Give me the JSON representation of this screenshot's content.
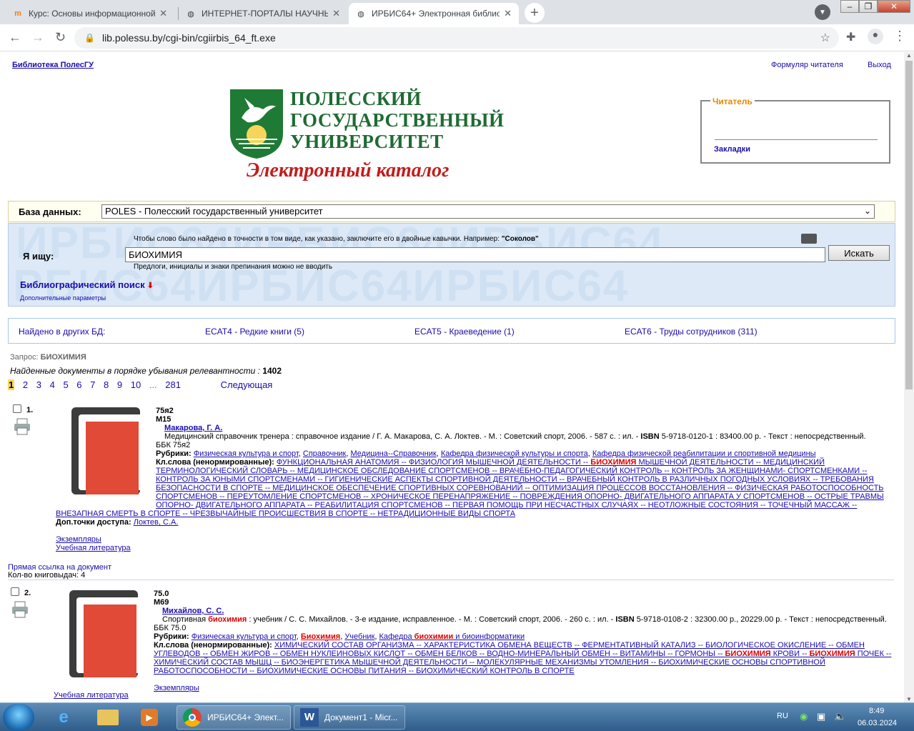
{
  "browser": {
    "tabs": [
      {
        "title": "Курс: Основы информационной ...",
        "favicon": "moodle-icon"
      },
      {
        "title": "ИНТЕРНЕТ-ПОРТАЛЫ НАУЧНЫХ ...",
        "favicon": "globe-icon"
      },
      {
        "title": "ИРБИС64+ Электронная библиотека",
        "favicon": "globe-icon"
      }
    ],
    "url": "lib.polessu.by/cgi-bin/cgiirbis_64_ft.exe"
  },
  "header": {
    "library_link": "Библиотека ПолесГУ",
    "reader_form_link": "Формуляр читателя",
    "logout_link": "Выход"
  },
  "logo": {
    "line1": "ПОЛЕССКИЙ",
    "line2": "ГОСУДАРСТВЕННЫЙ",
    "line3": "УНИВЕРСИТЕТ",
    "catalog": "Электронный каталог"
  },
  "reader_box": {
    "legend": "Читатель",
    "bookmarks": "Закладки"
  },
  "database": {
    "label": "База данных:",
    "selected": "POLES - Полесский государственный университет"
  },
  "search": {
    "hint_top_prefix": "Чтобы слово было найдено в точности в том виде, как указано, заключите его в двойные кавычки. Например:",
    "hint_top_example": "\"Соколов\"",
    "label": "Я ищу:",
    "query": "БИОХИМИЯ",
    "button": "Искать",
    "hint_bottom": "Предлоги, инициалы и знаки препинания можно не вводить",
    "biblio_link": "Библиографический поиск",
    "extra_link": "Дополнительные параметры"
  },
  "other_dbs": {
    "label": "Найдено в других БД:",
    "items": [
      "ECAT4 - Редкие книги (5)",
      "ECAT5 - Краеведение (1)",
      "ECAT6 - Труды сотрудников (311)"
    ]
  },
  "results": {
    "query_label": "Запрос:",
    "query_value": "БИОХИМИЯ",
    "found_label": "Найденные документы в порядке убывания релевантности :",
    "found_count": "1402",
    "pages": [
      "1",
      "2",
      "3",
      "4",
      "5",
      "6",
      "7",
      "8",
      "9",
      "10",
      "...",
      "281"
    ],
    "next": "Следующая"
  },
  "record1": {
    "num": "1.",
    "code1": "75я2",
    "code2": "М15",
    "author": "Макарова, Г. А.",
    "desc": "Медицинский справочник тренера : справочное издание / Г. А. Макарова, С. А. Локтев. - М. : Советский спорт, 2006. - 587 с. : ил. - ",
    "isbn_label": "ISBN",
    "isbn_rest": " 5-9718-0120-1 : 83400.00 р. - Текст : непосредственный.",
    "bbk": "ББК 75я2",
    "rubrics_label": "Рубрики:",
    "rubrics": [
      "Физическая культура и спорт",
      "Справочник",
      "Медицина--Справочник",
      "Кафедра физической культуры и спорта",
      "Кафедра физической реабилитации и спортивной медицины"
    ],
    "kw_label": "Кл.слова (ненормированные):",
    "kw_line1_a": "ФУНКЦИОНАЛЬНАЯ АНАТОМИЯ -- ФИЗИОЛОГИЯ МЫШЕЧНОЙ ДЕЯТЕЛЬНОСТИ -- ",
    "kw_line1_hl": "БИОХИМИЯ",
    "kw_line1_b": " МЫШЕЧНОЙ ДЕЯТЕЛЬНОСТИ -- МЕДИЦИНСКИЙ",
    "kw_lines": [
      "ТЕРМИНОЛОГИЧЕСКИЙ СЛОВАРЬ -- МЕДИЦИНСКОЕ ОБСЛЕДОВАНИЕ СПОРТСМЕНОВ -- ВРАЧЕБНО-ПЕДАГОГИЧЕСКИЙ КОНТРОЛЬ -- КОНТРОЛЬ ЗА ЖЕНЩИНАМИ- СПОРТСМЕНКАМИ --",
      "КОНТРОЛЬ ЗА ЮНЫМИ СПОРТСМЕНАМИ -- ГИГИЕНИЧЕСКИЕ АСПЕКТЫ СПОРТИВНОЙ ДЕЯТЕЛЬНОСТИ -- ВРАЧЕБНЫЙ КОНТРОЛЬ В РАЗЛИЧНЫХ ПОГОДНЫХ УСЛОВИЯХ -- ТРЕБОВАНИЯ",
      "БЕЗОПАСНОСТИ В СПОРТЕ -- МЕДИЦИНСКОЕ ОБЕСПЕЧЕНИЕ СПОРТИВНЫХ СОРЕВНОВАНИЙ -- ОПТИМИЗАЦИЯ ПРОЦЕССОВ ВОССТАНОВЛЕНИЯ -- ФИЗИЧЕСКАЯ РАБОТОСПОСОБНОСТЬ",
      "СПОРТСМЕНОВ -- ПЕРЕУТОМЛЕНИЕ СПОРТСМЕНОВ -- ХРОНИЧЕСКОЕ ПЕРЕНАПРЯЖЕНИЕ -- ПОВРЕЖДЕНИЯ ОПОРНО- ДВИГАТЕЛЬНОГО АППАРАТА У СПОРТСМЕНОВ -- ОСТРЫЕ ТРАВМЫ",
      "ОПОРНО- ДВИГАТЕЛЬНОГО АППАРАТА -- РЕАБИЛИТАЦИЯ СПОРТСМЕНОВ -- ПЕРВАЯ ПОМОЩЬ ПРИ НЕСЧАСТНЫХ СЛУЧАЯХ -- НЕОТЛОЖНЫЕ СОСТОЯНИЯ -- ТОЧЕЧНЫЙ МАССАЖ --"
    ],
    "kw_last": "ВНЕЗАПНАЯ СМЕРТЬ В СПОРТЕ -- ЧРЕЗВЫЧАЙНЫЕ ПРОИСШЕСТВИЯ В СПОРТЕ -- НЕТРАДИЦИОННЫЕ ВИДЫ СПОРТА",
    "extra_label": "Доп.точки доступа:",
    "extra_value": "Локтев, С.А.",
    "copies": "Экземпляры",
    "study": "Учебная литература",
    "direct_link": "Прямая ссылка на документ",
    "issues": "Кол-во книговыдач: 4"
  },
  "record2": {
    "num": "2.",
    "code1": "75.0",
    "code2": "М69",
    "author": "Михайлов, С. С.",
    "desc_a": "Спортивная ",
    "desc_hl": "биохимия",
    "desc_b": " : учебник / С. С. Михайлов. - 3-е издание, исправленное. - М. : Советский спорт, 2006. - 260 с. : ил. - ",
    "isbn_label": "ISBN",
    "isbn_rest": " 5-9718-0108-2 : 32300.00 р., 20229.00 р. - Текст : непосредственный.",
    "bbk": "ББК 75.0",
    "rubrics_label": "Рубрики:",
    "rub1": "Физическая культура и спорт",
    "rub2": "Биохимия",
    "rub3": "Учебник",
    "rub4_a": "Кафедра ",
    "rub4_hl": "биохимии",
    "rub4_b": " и биоинформатики",
    "kw_label": "Кл.слова (ненормированные):",
    "kw_line1": "ХИМИЧЕСКИЙ СОСТАВ ОРГАНИЗМА -- ХАРАКТЕРИСТИКА ОБМЕНА ВЕЩЕСТВ -- ФЕРМЕНТАТИВНЫЙ КАТАЛИЗ -- БИОЛОГИЧЕСКОЕ ОКИСЛЕНИЕ -- ОБМЕН",
    "kw_line2_a": "УГЛЕВОДОВ -- ОБМЕН ЖИРОВ -- ОБМЕН НУКЛЕИНОВЫХ КИСЛОТ -- ОБМЕН БЕЛКОВ -- ВОДНО-МИНЕРАЛЬНЫЙ ОБМЕН -- ВИТАМИНЫ -- ГОРМОНЫ -- ",
    "kw_line2_hl1": "БИОХИМИЯ",
    "kw_line2_b": " КРОВИ -- ",
    "kw_line2_hl2": "БИОХИМИЯ",
    "kw_line2_c": " ПОЧЕК --",
    "kw_line3": "ХИМИЧЕСКИЙ СОСТАВ МЫШЦ -- БИОЭНЕРГЕТИКА МЫШЕЧНОЙ ДЕЯТЕЛЬНОСТИ -- МОЛЕКУЛЯРНЫЕ МЕХАНИЗМЫ УТОМЛЕНИЯ -- БИОХИМИЧЕСКИЕ ОСНОВЫ СПОРТИВНОЙ",
    "kw_line4": "РАБОТОСПОСОБНОСТИ -- БИОХИМИЧЕСКИЕ ОСНОВЫ ПИТАНИЯ -- БИОХИМИЧЕСКИЙ КОНТРОЛЬ В СПОРТЕ",
    "copies": "Экземпляры",
    "study": "Учебная литература"
  },
  "taskbar": {
    "chrome_label": "ИРБИС64+ Элект...",
    "word_label": "Документ1 - Micr...",
    "lang": "RU",
    "time": "8:49",
    "date": "06.03.2024"
  }
}
